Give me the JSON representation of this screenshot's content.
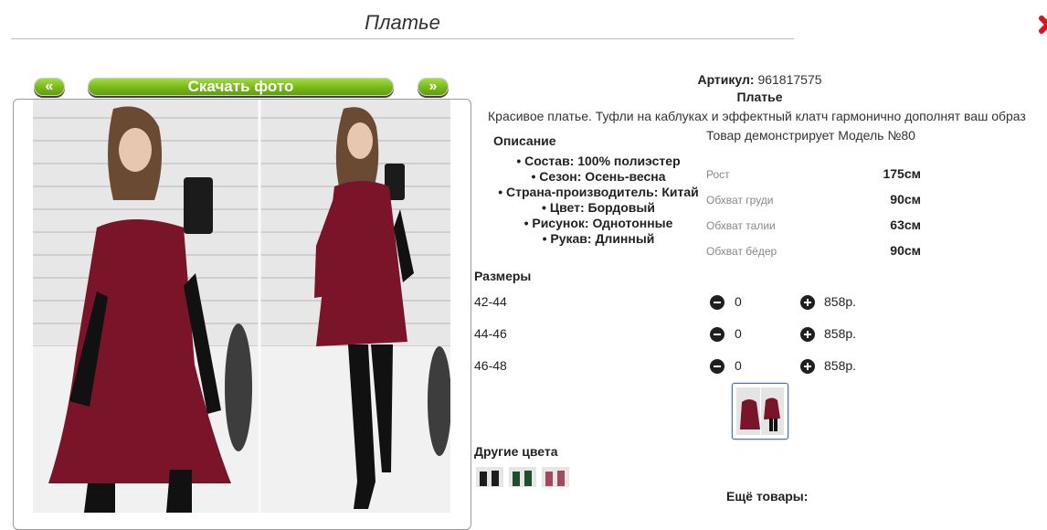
{
  "page": {
    "title": "Платье"
  },
  "gallery": {
    "prev_label": "«",
    "download_label": "Скачать фото",
    "next_label": "»"
  },
  "product": {
    "article_label": "Артикул:",
    "article_value": "961817575",
    "name": "Платье",
    "description": "Красивое платье. Туфли на каблуках и эффектный клатч гармонично дополнят ваш образ",
    "description_heading": "Описание",
    "attributes": [
      "Состав: 100% полиэстер",
      "Сезон: Осень-весна",
      "Страна-производитель: Китай",
      "Цвет: Бордовый",
      "Рисунок: Однотонные",
      "Рукав: Длинный"
    ],
    "color_hex": "#7a1428"
  },
  "model": {
    "heading": "Товар демонстрирует Модель №80",
    "params": [
      {
        "label": "Рост",
        "value": "175см"
      },
      {
        "label": "Обхват груди",
        "value": "90см"
      },
      {
        "label": "Обхват талии",
        "value": "63см"
      },
      {
        "label": "Обхват бёдер",
        "value": "90см"
      }
    ]
  },
  "sizes": {
    "heading": "Размеры",
    "rows": [
      {
        "size": "42-44",
        "qty": "0",
        "price": "858р."
      },
      {
        "size": "44-46",
        "qty": "0",
        "price": "858р."
      },
      {
        "size": "46-48",
        "qty": "0",
        "price": "858р."
      }
    ]
  },
  "other_colors": {
    "heading": "Другие цвета"
  },
  "more": {
    "heading": "Ещё товары:"
  },
  "colors": {
    "accent": "#76b81a",
    "close": "#d9141b"
  }
}
